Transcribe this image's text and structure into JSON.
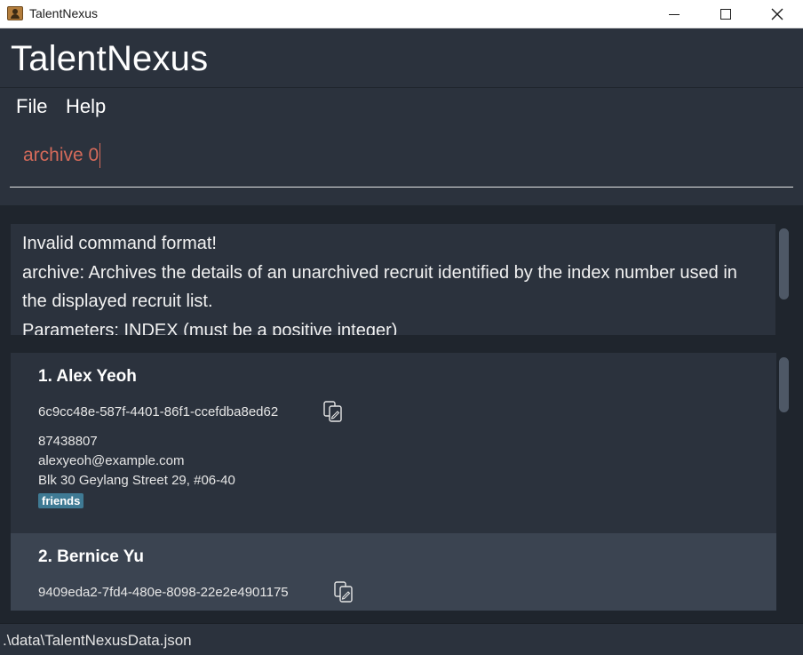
{
  "window": {
    "title": "TalentNexus"
  },
  "header": {
    "title": "TalentNexus"
  },
  "menu": {
    "file": "File",
    "help": "Help"
  },
  "command": {
    "value": "archive 0"
  },
  "result": {
    "lines": [
      "Invalid command format!",
      "archive: Archives the details of an unarchived recruit identified by the index number used in the displayed recruit list.",
      "Parameters: INDEX (must be a positive integer)"
    ]
  },
  "recruits": [
    {
      "name": "1.  Alex Yeoh",
      "uuid": "6c9cc48e-587f-4401-86f1-ccefdba8ed62",
      "phone": "87438807",
      "email": "alexyeoh@example.com",
      "address": "Blk 30 Geylang Street 29, #06-40",
      "tag": "friends"
    },
    {
      "name": "2.  Bernice Yu",
      "uuid": "9409eda2-7fd4-480e-8098-22e2e4901175"
    }
  ],
  "status": {
    "path": ".\\data\\TalentNexusData.json"
  },
  "icons": {
    "copy": "copy-icon",
    "app": "app-icon"
  },
  "colors": {
    "command_error": "#d46a5a",
    "tag": "#3f7a94"
  }
}
